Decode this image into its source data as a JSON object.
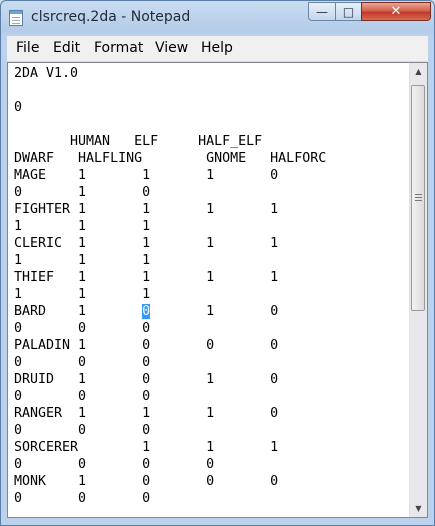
{
  "window": {
    "title": "clsrcreq.2da - Notepad"
  },
  "caption_buttons": {
    "minimize": "—",
    "maximize": "□",
    "close": "✕"
  },
  "menu": {
    "file": "File",
    "edit": "Edit",
    "format": "Format",
    "view": "View",
    "help": "Help"
  },
  "document": {
    "header_lines": [
      "2DA V1.0",
      "",
      "0",
      "",
      "       HUMAN   ELF     HALF_ELF",
      "DWARF   HALFLING        GNOME   HALFORC"
    ],
    "rows": [
      {
        "l1": "MAGE    1       1       1       0",
        "l2": "0       1       0"
      },
      {
        "l1": "FIGHTER 1       1       1       1",
        "l2": "1       1       1"
      },
      {
        "l1": "CLERIC  1       1       1       1",
        "l2": "1       1       1"
      },
      {
        "l1": "THIEF   1       1       1       1",
        "l2": "1       1       1"
      },
      {
        "l1_pre": "BARD    1       ",
        "l1_sel": "0",
        "l1_post": "       1       0",
        "l2": "0       0       0"
      },
      {
        "l1": "PALADIN 1       0       0       0",
        "l2": "0       0       0"
      },
      {
        "l1": "DRUID   1       0       1       0",
        "l2": "0       0       0"
      },
      {
        "l1": "RANGER  1       1       1       0",
        "l2": "0       0       0"
      },
      {
        "l1": "SORCERER        1       1       1",
        "l2": "0       0       0       0"
      },
      {
        "l1": "MONK    1       0       0       0",
        "l2": "0       0       0"
      }
    ]
  },
  "scrollbar": {
    "up": "▲",
    "down": "▼"
  },
  "icons": {
    "app": "notepad-icon"
  }
}
